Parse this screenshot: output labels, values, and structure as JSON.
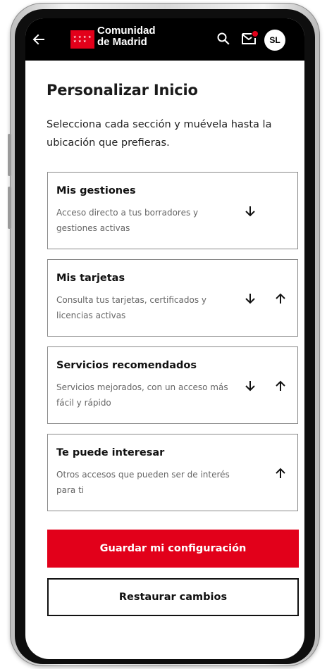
{
  "header": {
    "back_icon": "arrow-left-icon",
    "logo_line1": "Comunidad",
    "logo_line2": "de Madrid",
    "search_icon": "search-icon",
    "mail_icon": "mail-icon",
    "avatar_initials": "SL",
    "brand_color": "#e2001a"
  },
  "page": {
    "title": "Personalizar Inicio",
    "description": "Selecciona cada sección y muévela hasta la ubicación que prefieras."
  },
  "sections": [
    {
      "title": "Mis gestiones",
      "description": "Acceso directo a tus borradores y gestiones activas",
      "can_move_down": true,
      "can_move_up": false
    },
    {
      "title": "Mis tarjetas",
      "description": "Consulta tus tarjetas, certificados y licencias activas",
      "can_move_down": true,
      "can_move_up": true
    },
    {
      "title": "Servicios recomendados",
      "description": "Servicios mejorados, con un acceso más fácil y rápido",
      "can_move_down": true,
      "can_move_up": true
    },
    {
      "title": "Te puede interesar",
      "description": "Otros accesos que pueden ser de interés para ti",
      "can_move_down": false,
      "can_move_up": true
    }
  ],
  "actions": {
    "save_label": "Guardar mi configuración",
    "reset_label": "Restaurar cambios"
  }
}
